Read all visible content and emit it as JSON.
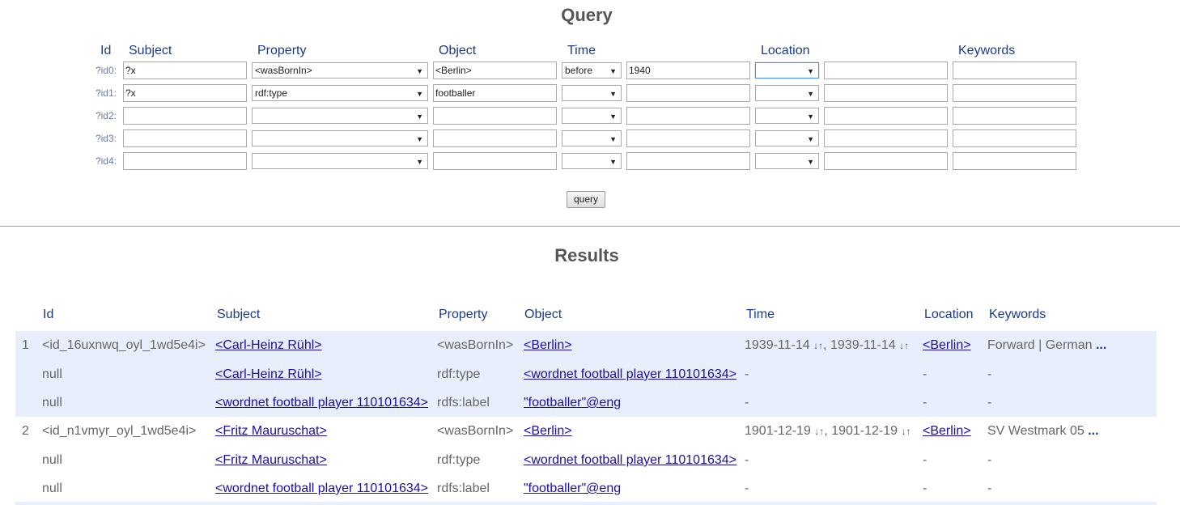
{
  "query": {
    "title": "Query",
    "headers": {
      "id": "Id",
      "subject": "Subject",
      "property": "Property",
      "object": "Object",
      "time": "Time",
      "location": "Location",
      "keywords": "Keywords"
    },
    "rows": [
      {
        "id": "?id0:",
        "subject": "?x",
        "property": "<wasBornIn>",
        "object": "<Berlin>",
        "time_op": "before",
        "time_value": "1940",
        "location_op": "",
        "location_value": "",
        "keywords": ""
      },
      {
        "id": "?id1:",
        "subject": "?x",
        "property": "rdf:type",
        "object": "footballer",
        "time_op": "",
        "time_value": "",
        "location_op": "",
        "location_value": "",
        "keywords": ""
      },
      {
        "id": "?id2:",
        "subject": "",
        "property": "",
        "object": "",
        "time_op": "",
        "time_value": "",
        "location_op": "",
        "location_value": "",
        "keywords": ""
      },
      {
        "id": "?id3:",
        "subject": "",
        "property": "",
        "object": "",
        "time_op": "",
        "time_value": "",
        "location_op": "",
        "location_value": "",
        "keywords": ""
      },
      {
        "id": "?id4:",
        "subject": "",
        "property": "",
        "object": "",
        "time_op": "",
        "time_value": "",
        "location_op": "",
        "location_value": "",
        "keywords": ""
      }
    ],
    "button_label": "query"
  },
  "results": {
    "title": "Results",
    "headers": {
      "id": "Id",
      "subject": "Subject",
      "property": "Property",
      "object": "Object",
      "time": "Time",
      "location": "Location",
      "keywords": "Keywords"
    },
    "groups": [
      {
        "num": "1",
        "band_color": "#e8eefc",
        "rows": [
          {
            "id": "<id_16uxnwq_oyl_1wd5e4i>",
            "subject": "<Carl-Heinz Rühl>",
            "property": "<wasBornIn>",
            "object": "<Berlin>",
            "time_a": "1939-11-14",
            "time_b": "1939-11-14",
            "location": "<Berlin>",
            "keywords": "Forward | German",
            "more": "..."
          },
          {
            "id": "null",
            "subject": "<Carl-Heinz Rühl>",
            "property": "rdf:type",
            "object": "<wordnet football player 110101634>",
            "time_text": "-",
            "location_text": "-",
            "keywords_text": "-"
          },
          {
            "id": "null",
            "subject": "<wordnet football player 110101634>",
            "property": "rdfs:label",
            "object": "\"footballer\"@eng",
            "time_text": "-",
            "location_text": "-",
            "keywords_text": "-"
          }
        ]
      },
      {
        "num": "2",
        "band_color": "#ffffff",
        "rows": [
          {
            "id": "<id_n1vmyr_oyl_1wd5e4i>",
            "subject": "<Fritz Mauruschat>",
            "property": "<wasBornIn>",
            "object": "<Berlin>",
            "time_a": "1901-12-19",
            "time_b": "1901-12-19",
            "location": "<Berlin>",
            "keywords": "SV Westmark 05",
            "more": "..."
          },
          {
            "id": "null",
            "subject": "<Fritz Mauruschat>",
            "property": "rdf:type",
            "object": "<wordnet football player 110101634>",
            "time_text": "-",
            "location_text": "-",
            "keywords_text": "-"
          },
          {
            "id": "null",
            "subject": "<wordnet football player 110101634>",
            "property": "rdfs:label",
            "object": "\"footballer\"@eng",
            "time_text": "-",
            "location_text": "-",
            "keywords_text": "-"
          }
        ]
      }
    ],
    "sort_icon": "↓↑"
  }
}
